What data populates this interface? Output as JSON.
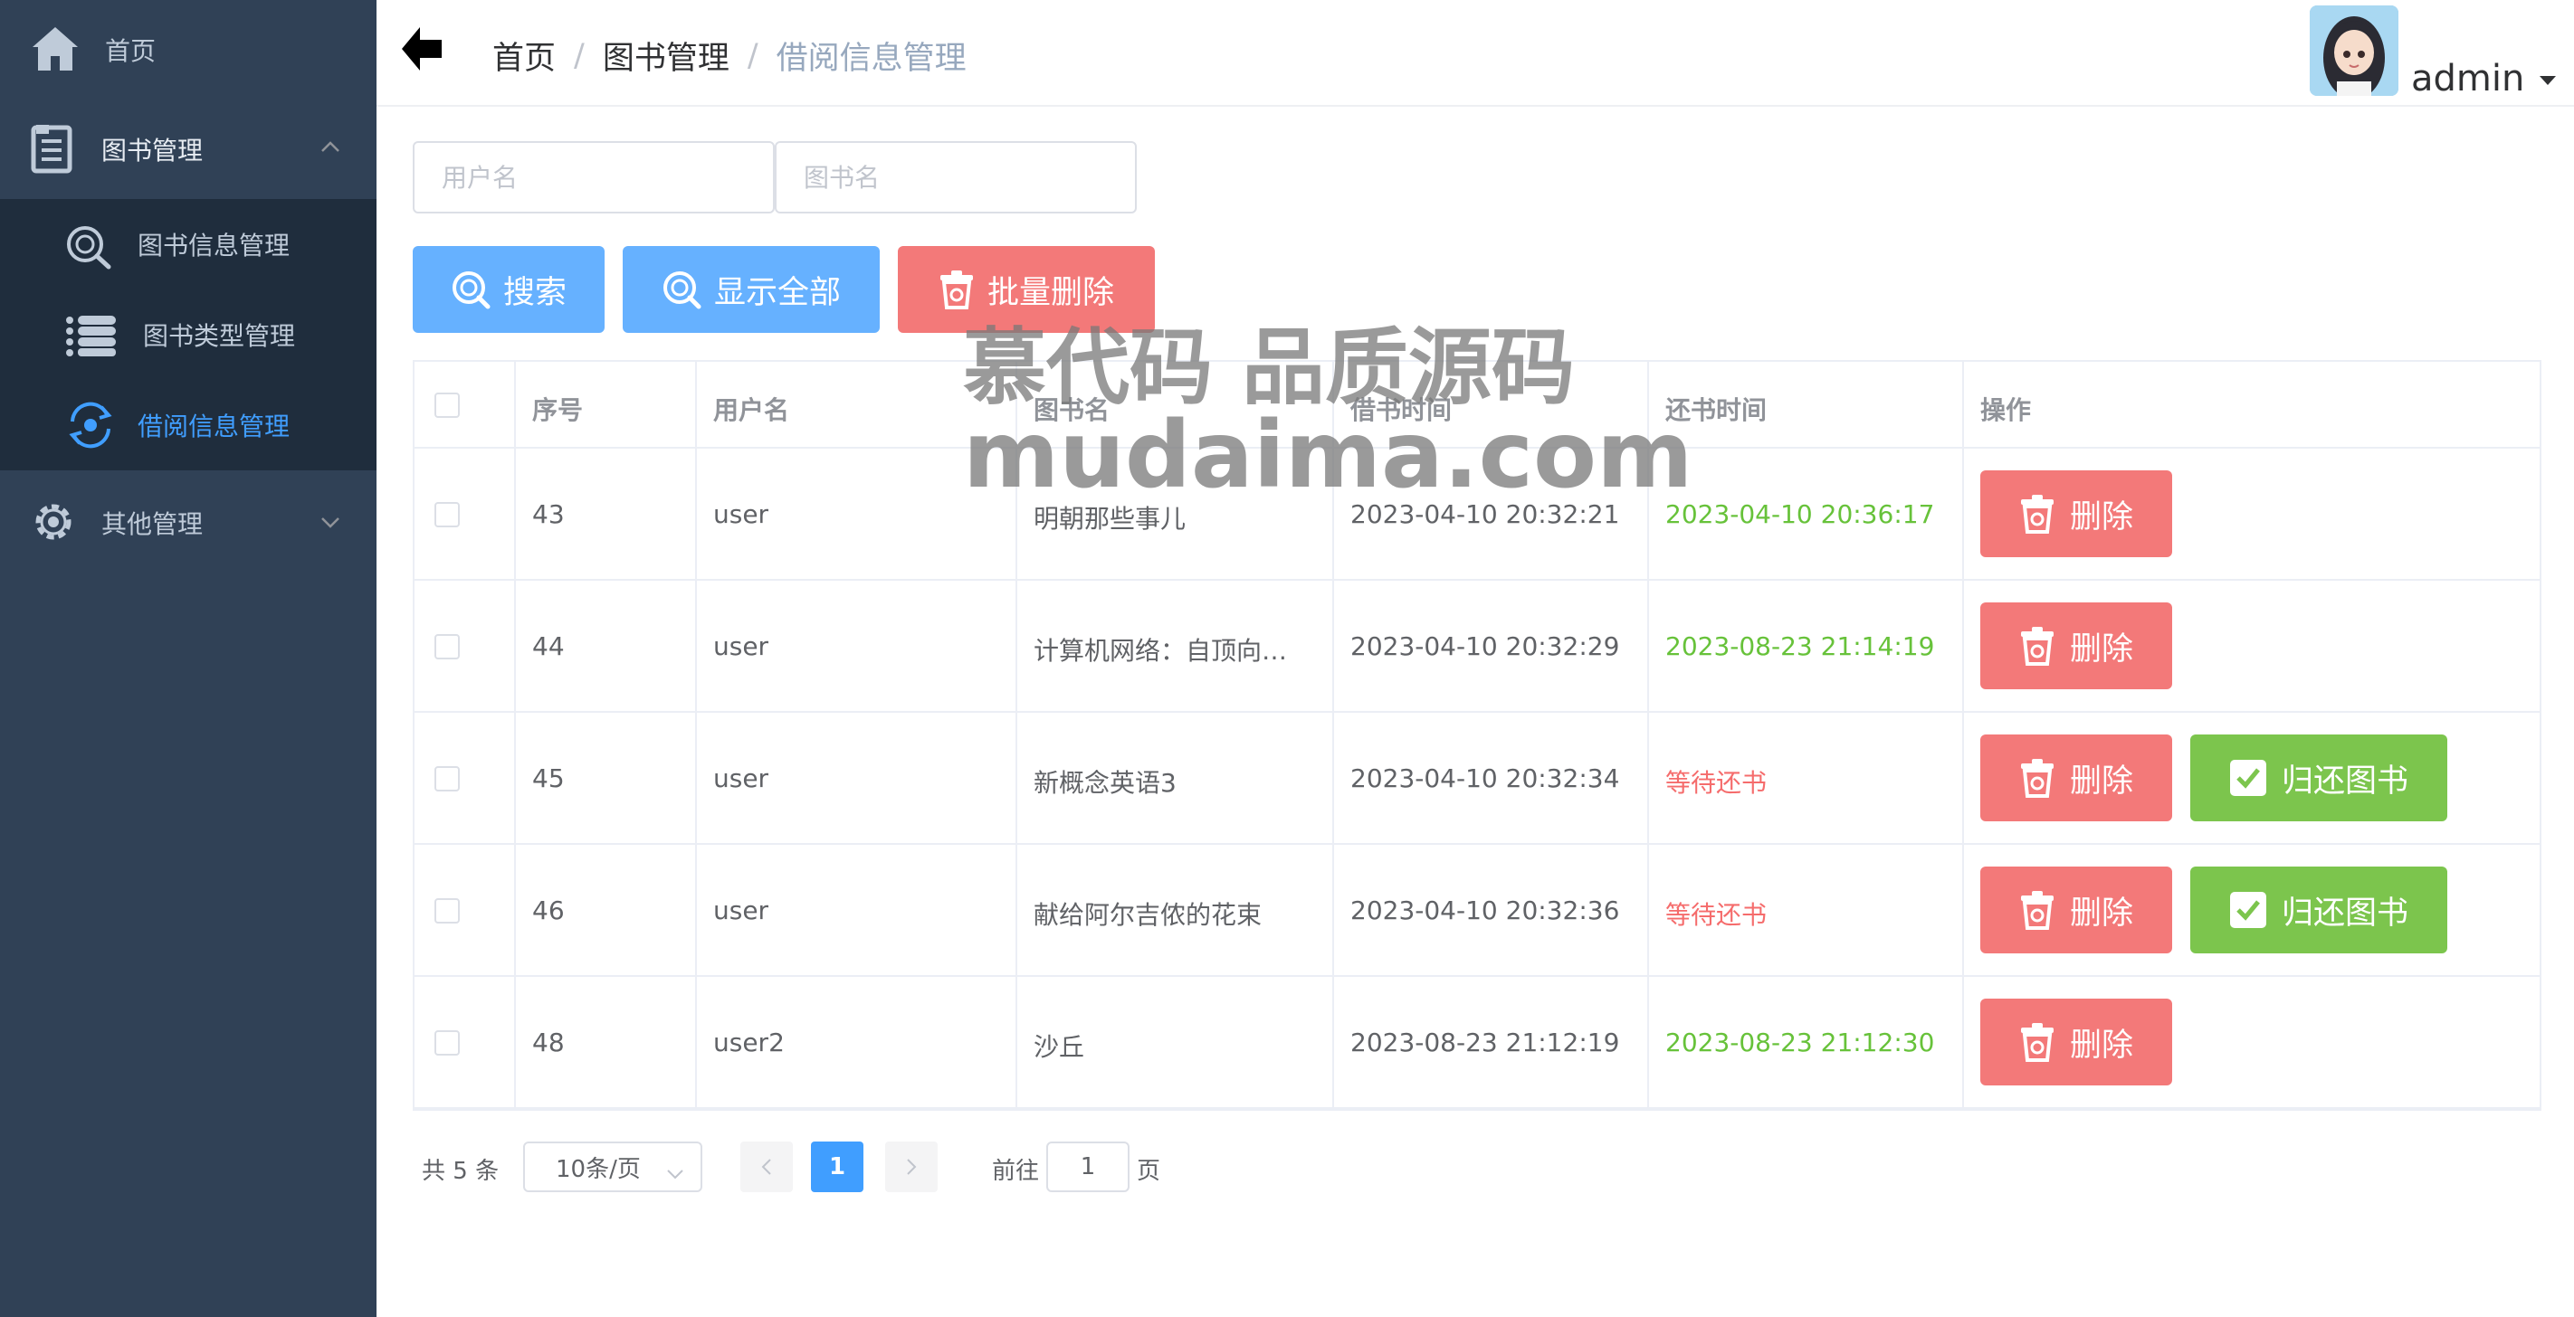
{
  "sidebar": {
    "home_label": "首页",
    "book_mgmt_label": "图书管理",
    "sub_items": [
      {
        "label": "图书信息管理"
      },
      {
        "label": "图书类型管理"
      },
      {
        "label": "借阅信息管理"
      }
    ],
    "other_mgmt_label": "其他管理"
  },
  "header": {
    "breadcrumb": [
      "首页",
      "图书管理",
      "借阅信息管理"
    ],
    "separator": "/",
    "user_name": "admin"
  },
  "search": {
    "username_placeholder": "用户名",
    "bookname_placeholder": "图书名",
    "search_label": "搜索",
    "show_all_label": "显示全部",
    "batch_delete_label": "批量删除"
  },
  "table": {
    "headers": [
      "序号",
      "用户名",
      "图书名",
      "借书时间",
      "还书时间",
      "操作"
    ],
    "delete_label": "删除",
    "return_label": "归还图书",
    "rows": [
      {
        "id": "43",
        "user": "user",
        "book": "明朝那些事儿",
        "borrow": "2023-04-10 20:32:21",
        "return": "2023-04-10 20:36:17",
        "status": "returned"
      },
      {
        "id": "44",
        "user": "user",
        "book": "计算机网络：自顶向…",
        "borrow": "2023-04-10 20:32:29",
        "return": "2023-08-23 21:14:19",
        "status": "returned"
      },
      {
        "id": "45",
        "user": "user",
        "book": "新概念英语3",
        "borrow": "2023-04-10 20:32:34",
        "return": "等待还书",
        "status": "waiting"
      },
      {
        "id": "46",
        "user": "user",
        "book": "献给阿尔吉侬的花束",
        "borrow": "2023-04-10 20:32:36",
        "return": "等待还书",
        "status": "waiting"
      },
      {
        "id": "48",
        "user": "user2",
        "book": "沙丘",
        "borrow": "2023-08-23 21:12:19",
        "return": "2023-08-23 21:12:30",
        "status": "returned"
      }
    ]
  },
  "pagination": {
    "total_text": "共 5 条",
    "page_size": "10条/页",
    "current_page": "1",
    "goto_prefix": "前往",
    "goto_value": "1",
    "goto_suffix": "页"
  },
  "watermark": {
    "line1": "慕代码 品质源码",
    "line2": "mudaima.com"
  },
  "colors": {
    "sidebar_bg": "#304156",
    "submenu_bg": "#1f2d3d",
    "active": "#409eff",
    "danger": "#f37979",
    "success": "#7cc54d",
    "returned_text": "#67c23a",
    "waiting_text": "#f56c6c"
  }
}
